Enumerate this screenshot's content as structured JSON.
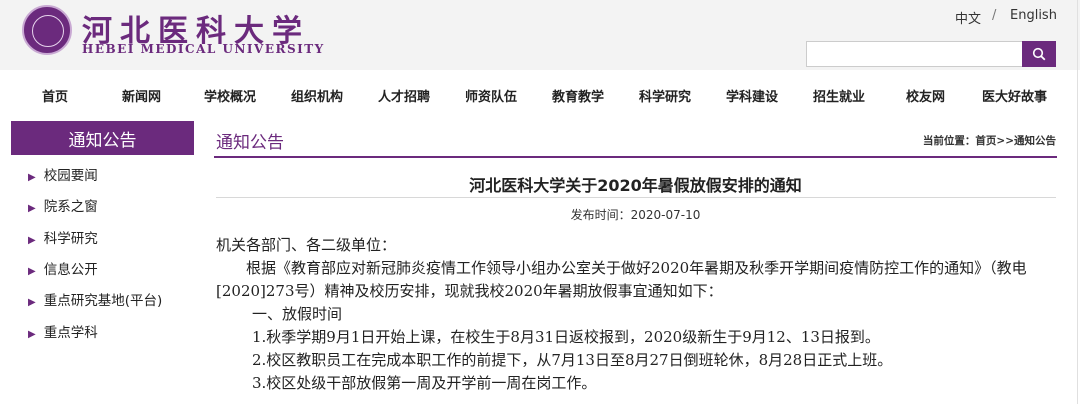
{
  "header": {
    "logo_cn": "河北医科大学",
    "logo_en": "HEBEI MEDICAL UNIVERSITY",
    "lang_zh": "中文",
    "lang_sep": "/",
    "lang_en": "English",
    "search_placeholder": ""
  },
  "nav": [
    "首页",
    "新闻网",
    "学校概况",
    "组织机构",
    "人才招聘",
    "师资队伍",
    "教育教学",
    "科学研究",
    "学科建设",
    "招生就业",
    "校友网",
    "医大好故事"
  ],
  "sidebar": {
    "title": "通知公告",
    "items": [
      "校园要闻",
      "院系之窗",
      "科学研究",
      "信息公开",
      "重点研究基地(平台)",
      "重点学科"
    ]
  },
  "main": {
    "section_title": "通知公告",
    "breadcrumb": "当前位置：首页>>通知公告",
    "article_title": "河北医科大学关于2020年暑假放假安排的通知",
    "publish_time": "发布时间：2020-07-10",
    "paragraphs": [
      "机关各部门、各二级单位：",
      "根据《教育部应对新冠肺炎疫情工作领导小组办公室关于做好2020年暑期及秋季开学期间疫情防控工作的通知》（教电[2020]273号）精神及校历安排，现就我校2020年暑期放假事宜通知如下：",
      "一、放假时间",
      "1.秋季学期9月1日开始上课，在校生于8月31日返校报到，2020级新生于9月12、13日报到。",
      "2.校区教职员工在完成本职工作的前提下，从7月13日至8月27日倒班轮休，8月28日正式上班。",
      "3.校区处级干部放假第一周及开学前一周在岗工作。"
    ]
  },
  "colors": {
    "brand": "#6b2a7d",
    "header_bg": "#f3f3f3"
  }
}
